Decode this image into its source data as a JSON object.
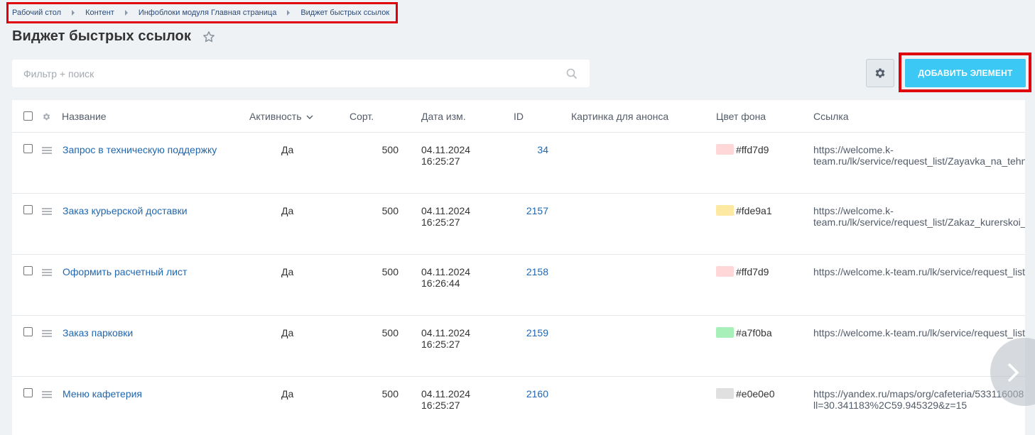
{
  "breadcrumb": [
    "Рабочий стол",
    "Контент",
    "Инфоблоки модуля Главная страница",
    "Виджет быстрых ссылок"
  ],
  "title": "Виджет быстрых ссылок",
  "filter": {
    "placeholder": "Фильтр + поиск"
  },
  "add_button": "ДОБАВИТЬ ЭЛЕМЕНТ",
  "columns": {
    "name": "Название",
    "active": "Активность",
    "sort": "Сорт.",
    "date": "Дата изм.",
    "id": "ID",
    "picture": "Картинка для анонса",
    "bg_color": "Цвет фона",
    "link": "Ссылка"
  },
  "rows": [
    {
      "name": "Запрос в техническую поддержку",
      "active": "Да",
      "sort": "500",
      "date": "04.11.2024",
      "time": "16:25:27",
      "id": "34",
      "color": "#ffd7d9",
      "link1": "https://welcome.k-",
      "link2": "team.ru/lk/service/request_list/Zayavka_na_tehn"
    },
    {
      "name": "Заказ курьерской доставки",
      "active": "Да",
      "sort": "500",
      "date": "04.11.2024",
      "time": "16:25:27",
      "id": "2157",
      "color": "#fde9a1",
      "link1": "https://welcome.k-",
      "link2": "team.ru/lk/service/request_list/Zakaz_kurerskoi_"
    },
    {
      "name": "Оформить расчетный лист",
      "active": "Да",
      "sort": "500",
      "date": "04.11.2024",
      "time": "16:26:44",
      "id": "2158",
      "color": "#ffd7d9",
      "link1": "https://welcome.k-team.ru/lk/service/request_list/",
      "link2": ""
    },
    {
      "name": "Заказ парковки",
      "active": "Да",
      "sort": "500",
      "date": "04.11.2024",
      "time": "16:25:27",
      "id": "2159",
      "color": "#a7f0ba",
      "link1": "https://welcome.k-team.ru/lk/service/request_list/",
      "link2": ""
    },
    {
      "name": "Меню кафетерия",
      "active": "Да",
      "sort": "500",
      "date": "04.11.2024",
      "time": "16:25:27",
      "id": "2160",
      "color": "#e0e0e0",
      "link1": "https://yandex.ru/maps/org/cafeteria/533116008",
      "link2": "ll=30.341183%2C59.945329&z=15"
    }
  ]
}
